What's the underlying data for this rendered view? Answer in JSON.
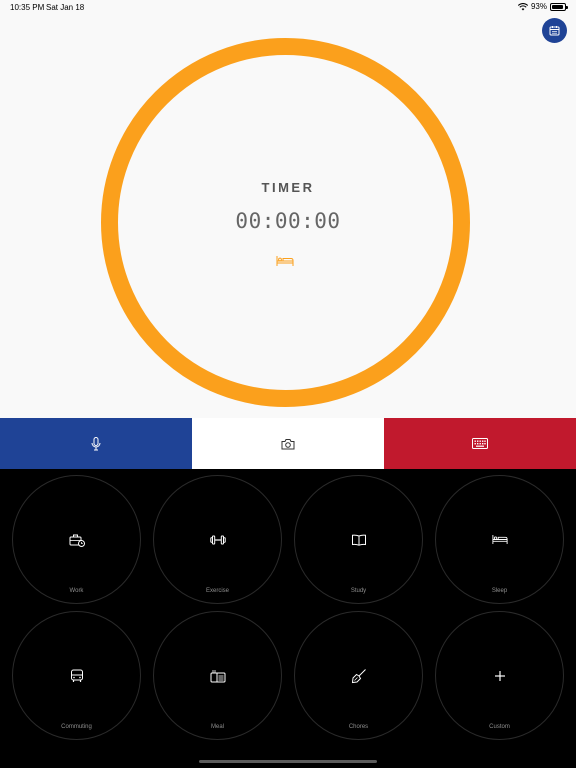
{
  "status_bar": {
    "time": "10:35 PM",
    "date": "Sat Jan 18",
    "battery": "93%",
    "battery_level": 0.93
  },
  "timer": {
    "label": "TIMER",
    "value": "00:00:00",
    "activity_icon": "bed-icon"
  },
  "colors": {
    "ring": "#fba01c",
    "blue": "#1f4396",
    "red": "#c1192d"
  },
  "actions": [
    {
      "icon": "microphone-icon"
    },
    {
      "icon": "camera-icon"
    },
    {
      "icon": "keyboard-icon"
    }
  ],
  "categories": [
    {
      "label": "Work",
      "icon": "briefcase-clock-icon"
    },
    {
      "label": "Exercise",
      "icon": "dumbbell-icon"
    },
    {
      "label": "Study",
      "icon": "book-icon"
    },
    {
      "label": "Sleep",
      "icon": "bed-icon"
    },
    {
      "label": "Commuting",
      "icon": "bus-icon"
    },
    {
      "label": "Meal",
      "icon": "lunchbox-icon"
    },
    {
      "label": "Chores",
      "icon": "broom-icon"
    },
    {
      "label": "Custom",
      "icon": "plus-icon"
    }
  ]
}
